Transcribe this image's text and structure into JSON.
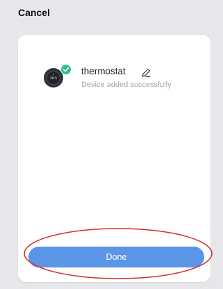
{
  "header": {
    "cancel_label": "Cancel"
  },
  "device": {
    "name": "thermostat",
    "status": "Device added successfully",
    "icon": "thermostat-icon",
    "icon_reading": "20.5",
    "badge_icon": "check-icon",
    "edit_icon": "pencil-icon"
  },
  "footer": {
    "done_label": "Done"
  },
  "colors": {
    "background": "#e6e7ea",
    "card": "#ffffff",
    "button": "#5a95e6",
    "badge": "#2fbf8a",
    "annotation": "#d62b2b"
  }
}
